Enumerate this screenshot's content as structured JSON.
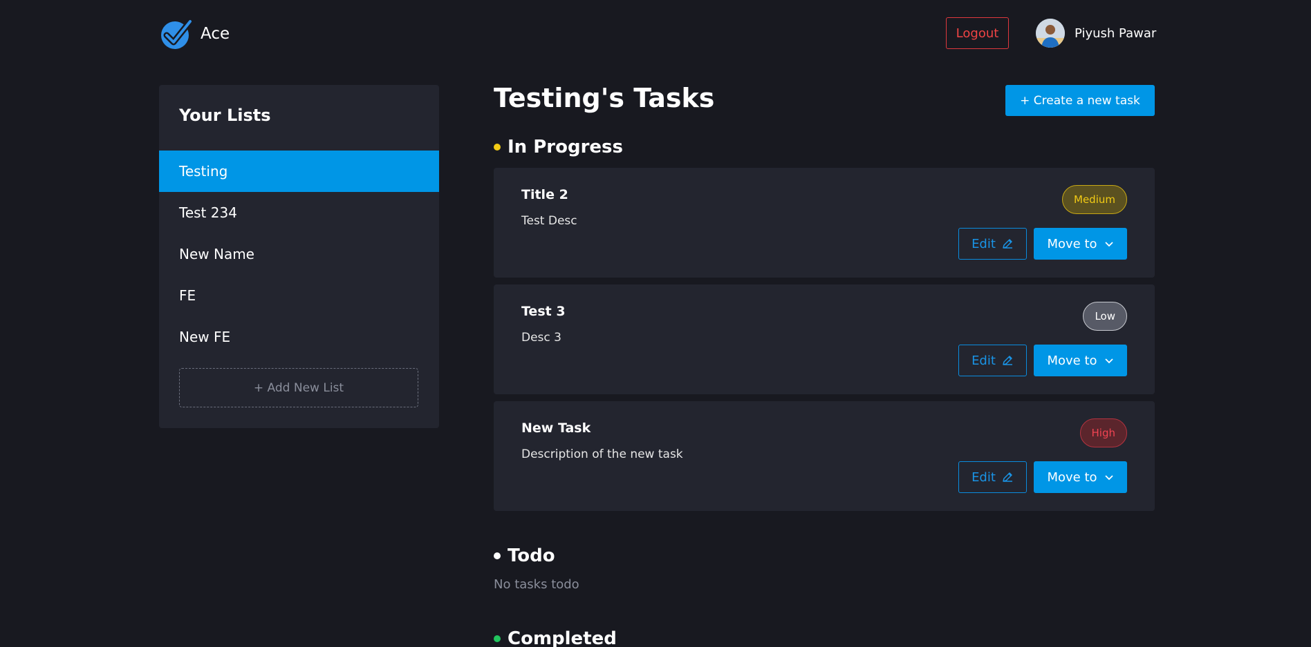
{
  "header": {
    "app_name": "Ace",
    "logout_label": "Logout",
    "user_name": "Piyush Pawar"
  },
  "sidebar": {
    "title": "Your Lists",
    "items": [
      {
        "label": "Testing",
        "active": true
      },
      {
        "label": "Test 234",
        "active": false
      },
      {
        "label": "New Name",
        "active": false
      },
      {
        "label": "FE",
        "active": false
      },
      {
        "label": "New FE",
        "active": false
      }
    ],
    "add_label": "+ Add New List"
  },
  "main": {
    "title": "Testing's Tasks",
    "create_label": "+ Create a new task",
    "sections": {
      "in_progress": {
        "title": "In Progress",
        "color": "#f2cb15",
        "tasks": [
          {
            "title": "Title 2",
            "desc": "Test Desc",
            "priority": "Medium",
            "edit_label": "Edit",
            "move_label": "Move to"
          },
          {
            "title": "Test 3",
            "desc": "Desc 3",
            "priority": "Low",
            "edit_label": "Edit",
            "move_label": "Move to"
          },
          {
            "title": "New Task",
            "desc": "Description of the new task",
            "priority": "High",
            "edit_label": "Edit",
            "move_label": "Move to"
          }
        ]
      },
      "todo": {
        "title": "Todo",
        "color": "#ffffff",
        "empty_text": "No tasks todo"
      },
      "completed": {
        "title": "Completed",
        "color": "#22c55e"
      }
    }
  },
  "colors": {
    "background": "#181920",
    "panel": "#23252f",
    "accent": "#0096e6",
    "danger": "#ef4444"
  }
}
